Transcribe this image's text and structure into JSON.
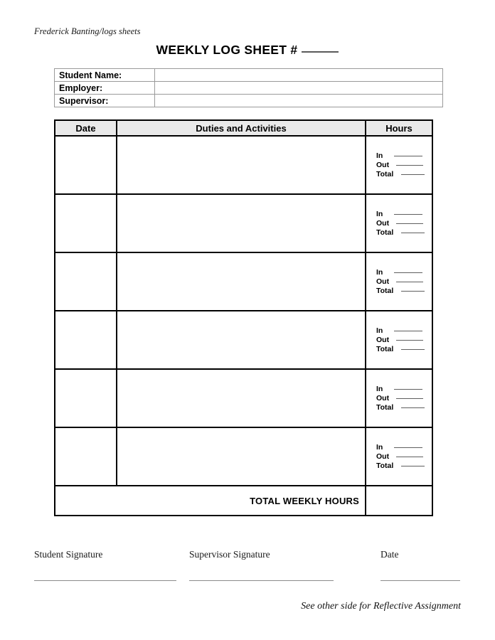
{
  "document": {
    "running_head": "Frederick Banting/logs sheets",
    "title": "WEEKLY LOG SHEET #",
    "footer_note": "See other side for Reflective Assignment"
  },
  "info_table": {
    "rows": [
      {
        "label": "Student Name:",
        "value": ""
      },
      {
        "label": "Employer:",
        "value": ""
      },
      {
        "label": "Supervisor:",
        "value": ""
      }
    ]
  },
  "log_table": {
    "headers": {
      "date": "Date",
      "duties": "Duties and Activities",
      "hours": "Hours"
    },
    "hours_fields": {
      "in": "In",
      "out": "Out",
      "total": "Total"
    },
    "rows": [
      {
        "date": "",
        "duties": "",
        "hours_in": "",
        "hours_out": "",
        "hours_total": ""
      },
      {
        "date": "",
        "duties": "",
        "hours_in": "",
        "hours_out": "",
        "hours_total": ""
      },
      {
        "date": "",
        "duties": "",
        "hours_in": "",
        "hours_out": "",
        "hours_total": ""
      },
      {
        "date": "",
        "duties": "",
        "hours_in": "",
        "hours_out": "",
        "hours_total": ""
      },
      {
        "date": "",
        "duties": "",
        "hours_in": "",
        "hours_out": "",
        "hours_total": ""
      },
      {
        "date": "",
        "duties": "",
        "hours_in": "",
        "hours_out": "",
        "hours_total": ""
      }
    ],
    "total_row": {
      "label": "TOTAL WEEKLY HOURS",
      "value": ""
    }
  },
  "signatures": {
    "student": "Student Signature",
    "supervisor": "Supervisor Signature",
    "date": "Date"
  },
  "colors": {
    "header_fill": "#e9e9e9",
    "table_border": "#000000",
    "info_border": "#9a9a9a",
    "rule": "#5f5f5f"
  }
}
